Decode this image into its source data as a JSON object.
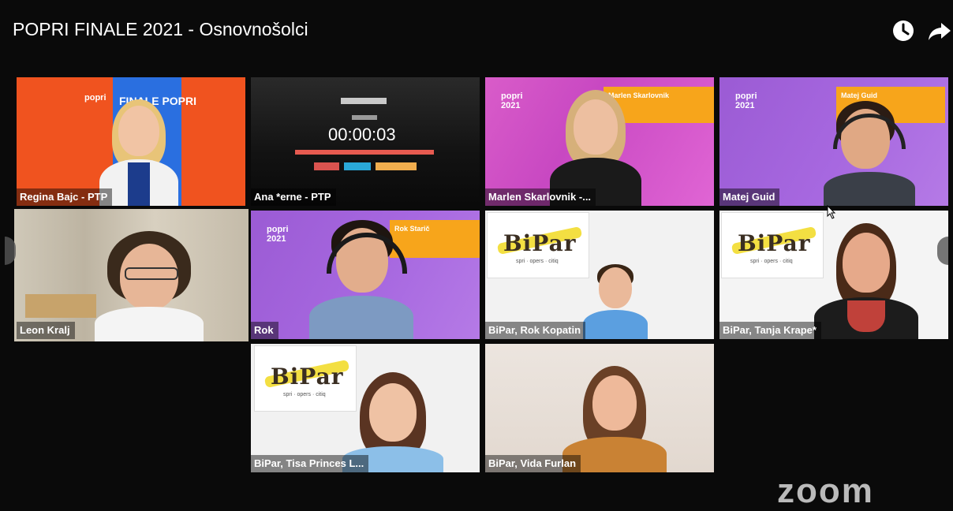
{
  "video": {
    "title": "POPRI FINALE 2021 - Osnovnošolci",
    "watch_later_icon": "clock-icon",
    "share_icon": "share-arrow-icon"
  },
  "participants": [
    {
      "label": "Regina Bajc - PTP"
    },
    {
      "label": "Ana *erne - PTP"
    },
    {
      "label": "Marlen Skarlovnik -..."
    },
    {
      "label": "Matej Guid"
    },
    {
      "label": "Leon Kralj"
    },
    {
      "label": "Rok"
    },
    {
      "label": "BiPar, Rok Kopatin"
    },
    {
      "label": "BiPar, Tanja Krape*"
    },
    {
      "label": "BiPar, Tisa Princes L..."
    },
    {
      "label": "BiPar, Vida Furlan"
    }
  ],
  "slide": {
    "heading": "FINALE POPRI",
    "popri": "popri"
  },
  "timer": {
    "value": "00:00:03"
  },
  "cards": {
    "marlen_name": "Marlen Skarlovnik",
    "matej_name": "Matej Guid",
    "rok_name": "Rok Starič",
    "popri_text": "popri",
    "year": "2021"
  },
  "bipar": {
    "word": "BiPar",
    "tagline": "spri · opers · citiq"
  },
  "watermark": "zoom",
  "colors": {
    "active_speaker": "#2ee82e",
    "popri_orange": "#f7a51b",
    "popri_pink": "#d95cc9",
    "popri_purple": "#9b5bd4"
  }
}
